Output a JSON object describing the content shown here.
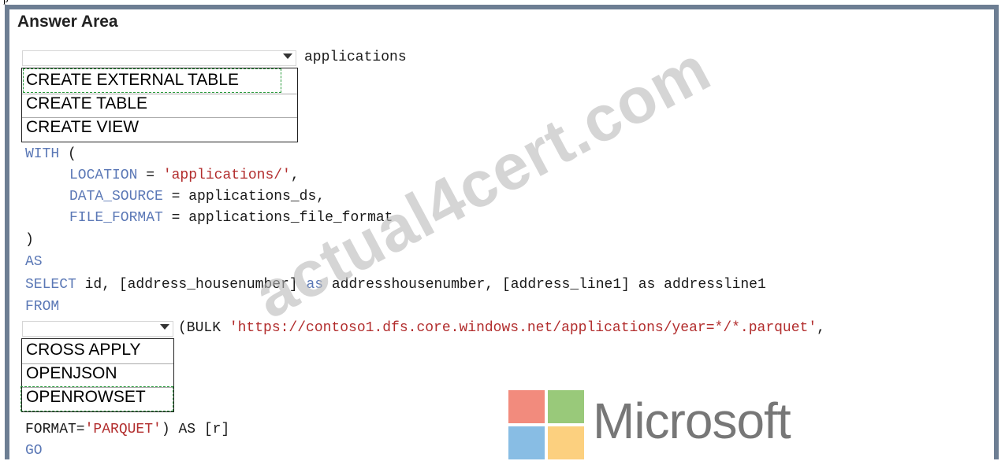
{
  "header": {
    "title": "Answer Area"
  },
  "stray_text": "p",
  "dropdown1": {
    "after_text": "applications",
    "options": [
      "CREATE EXTERNAL TABLE",
      "CREATE TABLE",
      "CREATE VIEW"
    ],
    "selected_index": 0
  },
  "code": {
    "with": "WITH",
    "paren_open": " (",
    "location_key": "LOCATION",
    "eq": " = ",
    "location_val": "'applications/'",
    "comma": ",",
    "data_source_key": "DATA_SOURCE",
    "data_source_val": "applications_ds,",
    "file_format_key": "FILE_FORMAT",
    "file_format_val": "applications_file_format",
    "paren_close": ")",
    "as": "AS",
    "select": "SELECT",
    "select_part1": " id, [address_housenumber] ",
    "as_inline": "as",
    "select_part2": " addresshousenumber, [address_line1] as addressline1",
    "from": "FROM",
    "bulk_prefix": "(BULK ",
    "bulk_url": "'https://contoso1.dfs.core.windows.net/applications/year=*/*.parquet'",
    "format_key": "FORMAT=",
    "format_val": "'PARQUET'",
    "format_rest": ") AS [r]",
    "go": "GO"
  },
  "dropdown2": {
    "options": [
      "CROSS APPLY",
      "OPENJSON",
      "OPENROWSET"
    ],
    "selected_index": 2
  },
  "watermark": "actual4cert.com",
  "ms_logo": {
    "text": "Microsoft",
    "colors": [
      "#f28b7d",
      "#99c97a",
      "#88bde4",
      "#fcd07f"
    ]
  }
}
